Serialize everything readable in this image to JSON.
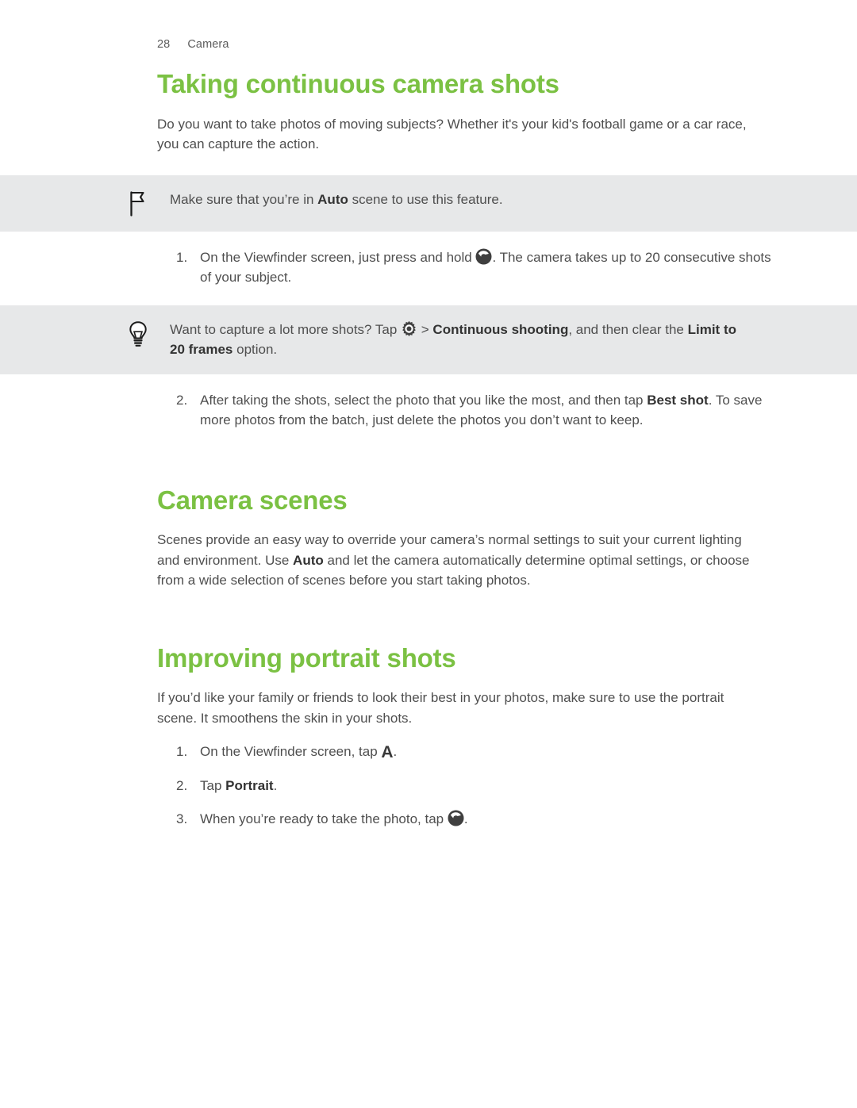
{
  "header": {
    "page_number": "28",
    "chapter": "Camera"
  },
  "colors": {
    "heading_green": "#7bc143",
    "body_text": "#4f4f4f",
    "callout_bg": "#e7e8e9",
    "bold_text": "#333333"
  },
  "sections": [
    {
      "title": "Taking continuous camera shots",
      "intro": "Do you want to take photos of moving subjects? Whether it's your kid's football game or a car race, you can capture the action."
    },
    {
      "title": "Camera scenes",
      "intro_part1": "Scenes provide an easy way to override your camera’s normal settings to suit your current lighting and environment. Use ",
      "intro_bold": "Auto",
      "intro_part2": " and let the camera automatically determine optimal settings, or choose from a wide selection of scenes before you start taking photos."
    },
    {
      "title": "Improving portrait shots",
      "intro": "If you’d like your family or friends to look their best in your photos, make sure to use the portrait scene. It smoothens the skin in your shots."
    }
  ],
  "note_box": {
    "icon": "flag-icon",
    "text_part1": "Make sure that you’re in ",
    "text_bold": "Auto",
    "text_part2": " scene to use this feature."
  },
  "tip_box": {
    "icon": "lightbulb-icon",
    "text_part1": "Want to capture a lot more shots? Tap ",
    "inline_icon": "gear-icon",
    "text_part2": " > ",
    "text_bold1": "Continuous shooting",
    "text_part3": ", and then clear the ",
    "text_bold2": "Limit to 20 frames",
    "text_part4": " option."
  },
  "continuous_steps": [
    {
      "num": "1.",
      "text_part1": "On the Viewfinder screen, just press and hold ",
      "inline_icon": "shutter-icon",
      "text_part2": ". The camera takes up to 20 consecutive shots of your subject."
    },
    {
      "num": "2.",
      "text_part1": "After taking the shots, select the photo that you like the most, and then tap ",
      "text_bold": "Best shot",
      "text_part2": ". To save more photos from the batch, just delete the photos you don’t want to keep."
    }
  ],
  "portrait_steps": [
    {
      "num": "1.",
      "text_part1": "On the Viewfinder screen, tap ",
      "inline_icon": "auto-scene-a-icon",
      "text_part2": "."
    },
    {
      "num": "2.",
      "text_part1": "Tap ",
      "text_bold": "Portrait",
      "text_part2": "."
    },
    {
      "num": "3.",
      "text_part1": "When you’re ready to take the photo, tap ",
      "inline_icon": "shutter-icon",
      "text_part2": "."
    }
  ]
}
